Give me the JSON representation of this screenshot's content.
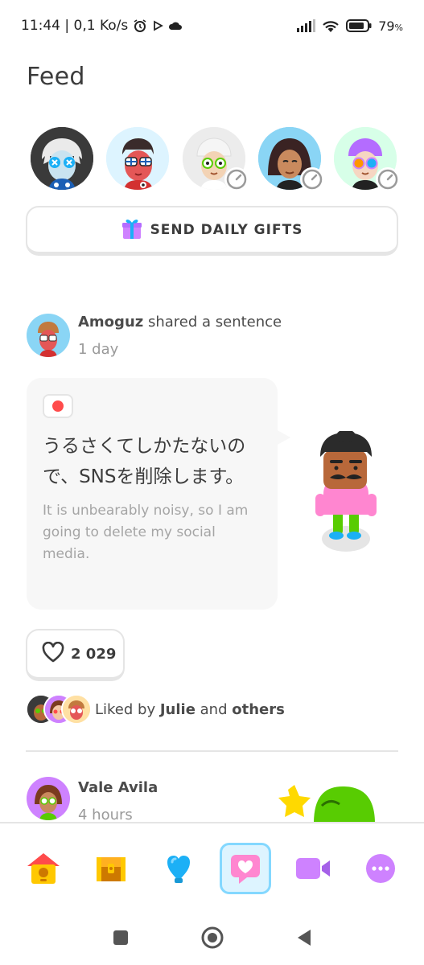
{
  "status_bar": {
    "time_speed": "11:44 | 0,1 Ko/s",
    "battery": "79",
    "battery_unit": "%",
    "icons": [
      "alarm-icon",
      "play-icon",
      "cloud-icon",
      "signal-icon",
      "wifi-icon",
      "battery-icon"
    ]
  },
  "header": {
    "title": "Feed"
  },
  "friends": [
    {
      "name": "friend-1",
      "badge": false
    },
    {
      "name": "friend-2",
      "badge": false
    },
    {
      "name": "friend-3",
      "badge": true
    },
    {
      "name": "friend-4",
      "badge": true
    },
    {
      "name": "friend-5",
      "badge": true
    }
  ],
  "gifts_button": {
    "label": "SEND DAILY GIFTS",
    "icon": "gift-icon"
  },
  "post": {
    "author": "Amoguz",
    "action": " shared a sentence",
    "time": "1 day",
    "sentence": "うるさくてしかたないので、SNSを削除します。",
    "translation": "It is unbearably noisy, so I am going to delete my social media.",
    "audio_icon": "audio-dot-icon",
    "likes": "2 029",
    "liked_by_prefix": "Liked by ",
    "liked_by_name": "Julie",
    "liked_by_and": " and ",
    "liked_by_others": "others"
  },
  "post2": {
    "author": "Vale Avila",
    "time": "4 hours"
  },
  "bottom_nav": [
    {
      "name": "home",
      "icon": "birdhouse-icon",
      "active": false
    },
    {
      "name": "chest",
      "icon": "treasure-chest-icon",
      "active": false
    },
    {
      "name": "leagues",
      "icon": "shield-icon",
      "active": false
    },
    {
      "name": "feed",
      "icon": "heart-chat-icon",
      "active": true
    },
    {
      "name": "video",
      "icon": "video-camera-icon",
      "active": false
    },
    {
      "name": "more",
      "icon": "more-dots-icon",
      "active": false
    }
  ],
  "colors": {
    "accent_blue": "#84d8ff",
    "like_red": "#ff4b4b",
    "text": "#4b4b4b",
    "muted": "#a5a5a5",
    "border": "#e5e5e5"
  }
}
